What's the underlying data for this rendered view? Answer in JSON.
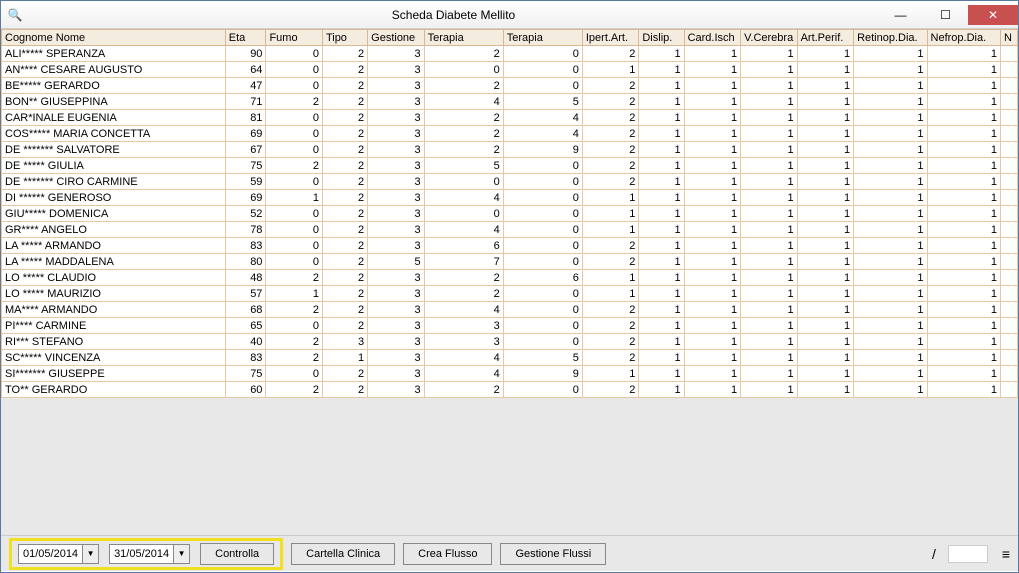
{
  "window": {
    "title": "Scheda Diabete Mellito",
    "icon": "🔍"
  },
  "columns": [
    {
      "key": "name",
      "label": "Cognome Nome",
      "width": 198,
      "align": "left"
    },
    {
      "key": "eta",
      "label": "Eta",
      "width": 36,
      "align": "right"
    },
    {
      "key": "fumo",
      "label": "Fumo",
      "width": 50,
      "align": "right"
    },
    {
      "key": "tipo",
      "label": "Tipo",
      "width": 40,
      "align": "right"
    },
    {
      "key": "gestione",
      "label": "Gestione",
      "width": 50,
      "align": "right"
    },
    {
      "key": "terapia1",
      "label": "Terapia",
      "width": 70,
      "align": "right"
    },
    {
      "key": "terapia2",
      "label": "Terapia",
      "width": 70,
      "align": "right"
    },
    {
      "key": "ipert",
      "label": "Ipert.Art.",
      "width": 50,
      "align": "right"
    },
    {
      "key": "dislip",
      "label": "Dislip.",
      "width": 40,
      "align": "right"
    },
    {
      "key": "cardisch",
      "label": "Card.Isch",
      "width": 50,
      "align": "right"
    },
    {
      "key": "vcerebra",
      "label": "V.Cerebra",
      "width": 50,
      "align": "right"
    },
    {
      "key": "artperif",
      "label": "Art.Perif.",
      "width": 50,
      "align": "right"
    },
    {
      "key": "retinop",
      "label": "Retinop.Dia.",
      "width": 65,
      "align": "right"
    },
    {
      "key": "nefrop",
      "label": "Nefrop.Dia.",
      "width": 65,
      "align": "right"
    },
    {
      "key": "extra",
      "label": "N",
      "width": 15,
      "align": "left"
    }
  ],
  "rows": [
    {
      "name": "ALI***** SPERANZA",
      "eta": 90,
      "fumo": 0,
      "tipo": 2,
      "gestione": 3,
      "terapia1": 2,
      "terapia2": 0,
      "ipert": 2,
      "dislip": 1,
      "cardisch": 1,
      "vcerebra": 1,
      "artperif": 1,
      "retinop": 1,
      "nefrop": 1
    },
    {
      "name": "AN**** CESARE AUGUSTO",
      "eta": 64,
      "fumo": 0,
      "tipo": 2,
      "gestione": 3,
      "terapia1": 0,
      "terapia2": 0,
      "ipert": 1,
      "dislip": 1,
      "cardisch": 1,
      "vcerebra": 1,
      "artperif": 1,
      "retinop": 1,
      "nefrop": 1
    },
    {
      "name": "BE***** GERARDO",
      "eta": 47,
      "fumo": 0,
      "tipo": 2,
      "gestione": 3,
      "terapia1": 2,
      "terapia2": 0,
      "ipert": 2,
      "dislip": 1,
      "cardisch": 1,
      "vcerebra": 1,
      "artperif": 1,
      "retinop": 1,
      "nefrop": 1
    },
    {
      "name": "BON** GIUSEPPINA",
      "eta": 71,
      "fumo": 2,
      "tipo": 2,
      "gestione": 3,
      "terapia1": 4,
      "terapia2": 5,
      "ipert": 2,
      "dislip": 1,
      "cardisch": 1,
      "vcerebra": 1,
      "artperif": 1,
      "retinop": 1,
      "nefrop": 1
    },
    {
      "name": "CAR*INALE EUGENIA",
      "eta": 81,
      "fumo": 0,
      "tipo": 2,
      "gestione": 3,
      "terapia1": 2,
      "terapia2": 4,
      "ipert": 2,
      "dislip": 1,
      "cardisch": 1,
      "vcerebra": 1,
      "artperif": 1,
      "retinop": 1,
      "nefrop": 1
    },
    {
      "name": "COS***** MARIA CONCETTA",
      "eta": 69,
      "fumo": 0,
      "tipo": 2,
      "gestione": 3,
      "terapia1": 2,
      "terapia2": 4,
      "ipert": 2,
      "dislip": 1,
      "cardisch": 1,
      "vcerebra": 1,
      "artperif": 1,
      "retinop": 1,
      "nefrop": 1
    },
    {
      "name": "DE ******* SALVATORE",
      "eta": 67,
      "fumo": 0,
      "tipo": 2,
      "gestione": 3,
      "terapia1": 2,
      "terapia2": 9,
      "ipert": 2,
      "dislip": 1,
      "cardisch": 1,
      "vcerebra": 1,
      "artperif": 1,
      "retinop": 1,
      "nefrop": 1
    },
    {
      "name": "DE ***** GIULIA",
      "eta": 75,
      "fumo": 2,
      "tipo": 2,
      "gestione": 3,
      "terapia1": 5,
      "terapia2": 0,
      "ipert": 2,
      "dislip": 1,
      "cardisch": 1,
      "vcerebra": 1,
      "artperif": 1,
      "retinop": 1,
      "nefrop": 1
    },
    {
      "name": "DE ******* CIRO CARMINE",
      "eta": 59,
      "fumo": 0,
      "tipo": 2,
      "gestione": 3,
      "terapia1": 0,
      "terapia2": 0,
      "ipert": 2,
      "dislip": 1,
      "cardisch": 1,
      "vcerebra": 1,
      "artperif": 1,
      "retinop": 1,
      "nefrop": 1
    },
    {
      "name": "DI ****** GENEROSO",
      "eta": 69,
      "fumo": 1,
      "tipo": 2,
      "gestione": 3,
      "terapia1": 4,
      "terapia2": 0,
      "ipert": 1,
      "dislip": 1,
      "cardisch": 1,
      "vcerebra": 1,
      "artperif": 1,
      "retinop": 1,
      "nefrop": 1
    },
    {
      "name": "GIU***** DOMENICA",
      "eta": 52,
      "fumo": 0,
      "tipo": 2,
      "gestione": 3,
      "terapia1": 0,
      "terapia2": 0,
      "ipert": 1,
      "dislip": 1,
      "cardisch": 1,
      "vcerebra": 1,
      "artperif": 1,
      "retinop": 1,
      "nefrop": 1
    },
    {
      "name": "GR**** ANGELO",
      "eta": 78,
      "fumo": 0,
      "tipo": 2,
      "gestione": 3,
      "terapia1": 4,
      "terapia2": 0,
      "ipert": 1,
      "dislip": 1,
      "cardisch": 1,
      "vcerebra": 1,
      "artperif": 1,
      "retinop": 1,
      "nefrop": 1
    },
    {
      "name": "LA ***** ARMANDO",
      "eta": 83,
      "fumo": 0,
      "tipo": 2,
      "gestione": 3,
      "terapia1": 6,
      "terapia2": 0,
      "ipert": 2,
      "dislip": 1,
      "cardisch": 1,
      "vcerebra": 1,
      "artperif": 1,
      "retinop": 1,
      "nefrop": 1
    },
    {
      "name": "LA ***** MADDALENA",
      "eta": 80,
      "fumo": 0,
      "tipo": 2,
      "gestione": 5,
      "terapia1": 7,
      "terapia2": 0,
      "ipert": 2,
      "dislip": 1,
      "cardisch": 1,
      "vcerebra": 1,
      "artperif": 1,
      "retinop": 1,
      "nefrop": 1
    },
    {
      "name": "LO ***** CLAUDIO",
      "eta": 48,
      "fumo": 2,
      "tipo": 2,
      "gestione": 3,
      "terapia1": 2,
      "terapia2": 6,
      "ipert": 1,
      "dislip": 1,
      "cardisch": 1,
      "vcerebra": 1,
      "artperif": 1,
      "retinop": 1,
      "nefrop": 1
    },
    {
      "name": "LO ***** MAURIZIO",
      "eta": 57,
      "fumo": 1,
      "tipo": 2,
      "gestione": 3,
      "terapia1": 2,
      "terapia2": 0,
      "ipert": 1,
      "dislip": 1,
      "cardisch": 1,
      "vcerebra": 1,
      "artperif": 1,
      "retinop": 1,
      "nefrop": 1
    },
    {
      "name": "MA**** ARMANDO",
      "eta": 68,
      "fumo": 2,
      "tipo": 2,
      "gestione": 3,
      "terapia1": 4,
      "terapia2": 0,
      "ipert": 2,
      "dislip": 1,
      "cardisch": 1,
      "vcerebra": 1,
      "artperif": 1,
      "retinop": 1,
      "nefrop": 1
    },
    {
      "name": "PI**** CARMINE",
      "eta": 65,
      "fumo": 0,
      "tipo": 2,
      "gestione": 3,
      "terapia1": 3,
      "terapia2": 0,
      "ipert": 2,
      "dislip": 1,
      "cardisch": 1,
      "vcerebra": 1,
      "artperif": 1,
      "retinop": 1,
      "nefrop": 1
    },
    {
      "name": "RI*** STEFANO",
      "eta": 40,
      "fumo": 2,
      "tipo": 3,
      "gestione": 3,
      "terapia1": 3,
      "terapia2": 0,
      "ipert": 2,
      "dislip": 1,
      "cardisch": 1,
      "vcerebra": 1,
      "artperif": 1,
      "retinop": 1,
      "nefrop": 1
    },
    {
      "name": "SC***** VINCENZA",
      "eta": 83,
      "fumo": 2,
      "tipo": 1,
      "gestione": 3,
      "terapia1": 4,
      "terapia2": 5,
      "ipert": 2,
      "dislip": 1,
      "cardisch": 1,
      "vcerebra": 1,
      "artperif": 1,
      "retinop": 1,
      "nefrop": 1
    },
    {
      "name": "SI******* GIUSEPPE",
      "eta": 75,
      "fumo": 0,
      "tipo": 2,
      "gestione": 3,
      "terapia1": 4,
      "terapia2": 9,
      "ipert": 1,
      "dislip": 1,
      "cardisch": 1,
      "vcerebra": 1,
      "artperif": 1,
      "retinop": 1,
      "nefrop": 1
    },
    {
      "name": "TO** GERARDO",
      "eta": 60,
      "fumo": 2,
      "tipo": 2,
      "gestione": 3,
      "terapia1": 2,
      "terapia2": 0,
      "ipert": 2,
      "dislip": 1,
      "cardisch": 1,
      "vcerebra": 1,
      "artperif": 1,
      "retinop": 1,
      "nefrop": 1
    }
  ],
  "footer": {
    "date_from": "01/05/2014",
    "date_to": "31/05/2014",
    "btn_controlla": "Controlla",
    "btn_cartella": "Cartella Clinica",
    "btn_crea": "Crea Flusso",
    "btn_gestione": "Gestione Flussi",
    "slash": "/"
  }
}
